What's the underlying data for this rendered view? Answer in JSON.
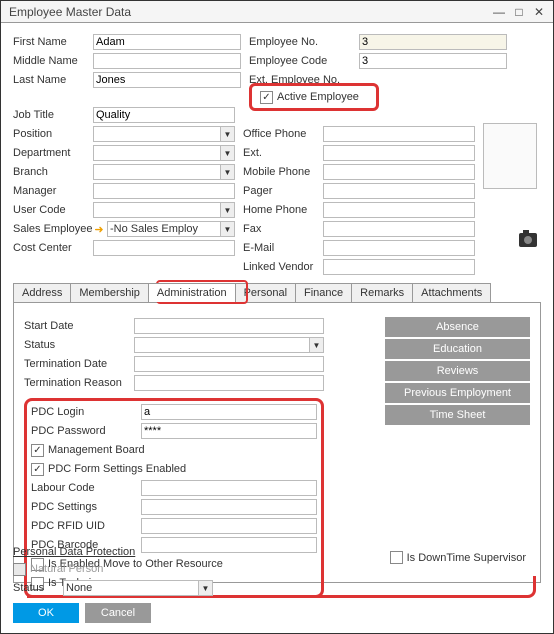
{
  "title": "Employee Master Data",
  "labels": {
    "first_name": "First Name",
    "middle_name": "Middle Name",
    "last_name": "Last Name",
    "emp_no": "Employee No.",
    "emp_code": "Employee Code",
    "ext_emp_no": "Ext. Employee No.",
    "active_emp": "Active Employee",
    "job_title": "Job Title",
    "position": "Position",
    "department": "Department",
    "branch": "Branch",
    "manager": "Manager",
    "user_code": "User Code",
    "sales_emp": "Sales Employee",
    "cost_center": "Cost Center",
    "office_phone": "Office Phone",
    "ext": "Ext.",
    "mobile_phone": "Mobile Phone",
    "pager": "Pager",
    "home_phone": "Home Phone",
    "fax": "Fax",
    "email": "E-Mail",
    "linked_vendor": "Linked Vendor"
  },
  "values": {
    "first_name": "Adam",
    "middle_name": "",
    "last_name": "Jones",
    "emp_no": "3",
    "emp_code": "3",
    "active_emp": true,
    "job_title": "Quality",
    "sales_emp": "-No Sales Employ"
  },
  "tabs": [
    "Address",
    "Membership",
    "Administration",
    "Personal",
    "Finance",
    "Remarks",
    "Attachments"
  ],
  "active_tab": "Administration",
  "admin": {
    "labels": {
      "start_date": "Start Date",
      "status": "Status",
      "term_date": "Termination Date",
      "term_reason": "Termination Reason",
      "pdc_login": "PDC Login",
      "pdc_password": "PDC Password",
      "mgmt_board": "Management Board",
      "pdc_form_settings": "PDC Form Settings Enabled",
      "labour_code": "Labour Code",
      "pdc_settings": "PDC Settings",
      "pdc_rfid": "PDC RFID UID",
      "pdc_barcode": "PDC Barcode",
      "move_other": "Is Enabled Move to Other Resource",
      "is_technician": "Is Technican",
      "is_downtime": "Is DownTime Supervisor"
    },
    "values": {
      "pdc_login": "a",
      "pdc_password": "****",
      "mgmt_board": true,
      "pdc_form_settings": true,
      "move_other": false,
      "is_technician": false,
      "is_downtime": false
    },
    "side_buttons": [
      "Absence",
      "Education",
      "Reviews",
      "Previous Employment",
      "Time Sheet"
    ]
  },
  "footer": {
    "pdp_title": "Personal Data Protection",
    "natural_person": "Natural Person",
    "status_label": "Status",
    "status_value": "None",
    "ok": "OK",
    "cancel": "Cancel"
  }
}
